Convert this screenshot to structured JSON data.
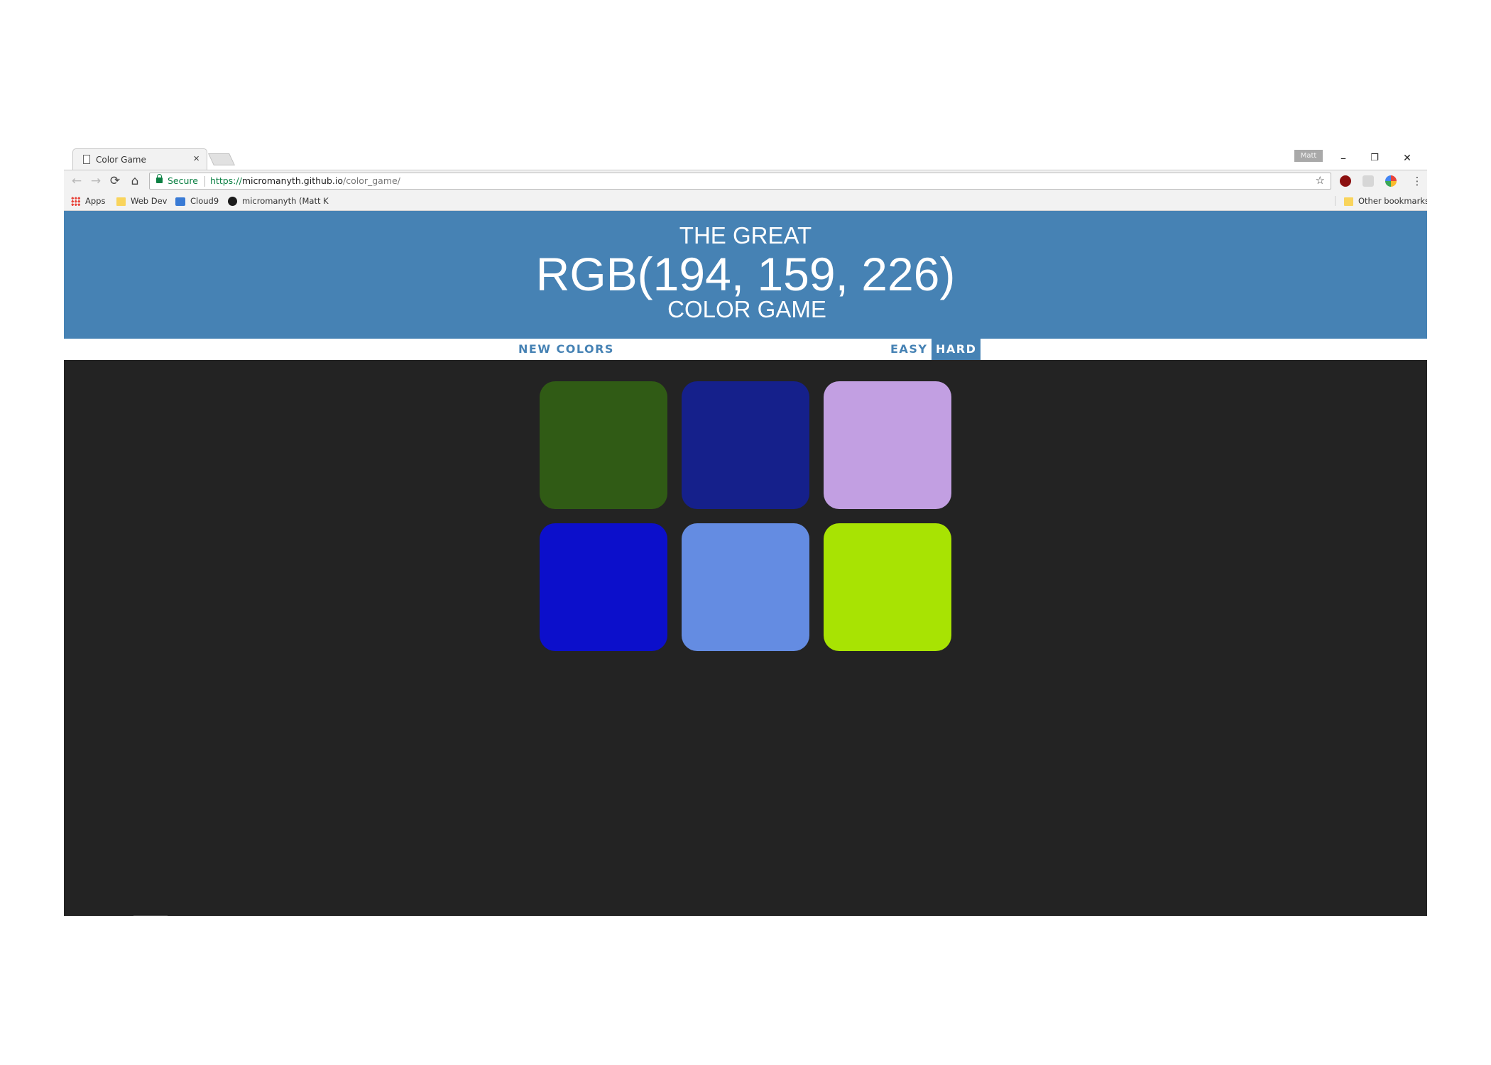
{
  "browser": {
    "tab": {
      "title": "Color Game"
    },
    "profile_name": "Matt",
    "controls": {
      "minimize": "–",
      "restore": "❐",
      "close": "✕"
    },
    "nav": {
      "back": "←",
      "forward": "→",
      "reload": "⟳",
      "home": "⌂"
    },
    "address": {
      "secure_label": "Secure",
      "scheme": "https://",
      "host": "micromanyth.github.io",
      "path": "/color_game/"
    },
    "bookmarks": [
      {
        "label": "Apps",
        "icon": "apps-grid-icon"
      },
      {
        "label": "Web Dev",
        "icon": "folder-icon"
      },
      {
        "label": "Cloud9",
        "icon": "cloud9-icon"
      },
      {
        "label": "micromanyth (Matt K",
        "icon": "github-icon"
      }
    ],
    "other_bookmarks": "Other bookmarks"
  },
  "game": {
    "title_top": "THE GREAT",
    "rgb_display": "RGB(194, 159, 226)",
    "title_bottom": "COLOR GAME",
    "new_colors_label": "NEW COLORS",
    "message": "",
    "easy_label": "EASY",
    "hard_label": "HARD",
    "selected_mode": "HARD",
    "header_color": "#4682b4",
    "body_color": "#232323",
    "squares": [
      "rgb(48, 91, 21)",
      "rgb(21, 32, 139)",
      "rgb(194, 159, 226)",
      "rgb(12, 15, 203)",
      "rgb(100, 140, 226)",
      "rgb(168, 227, 3)"
    ]
  }
}
